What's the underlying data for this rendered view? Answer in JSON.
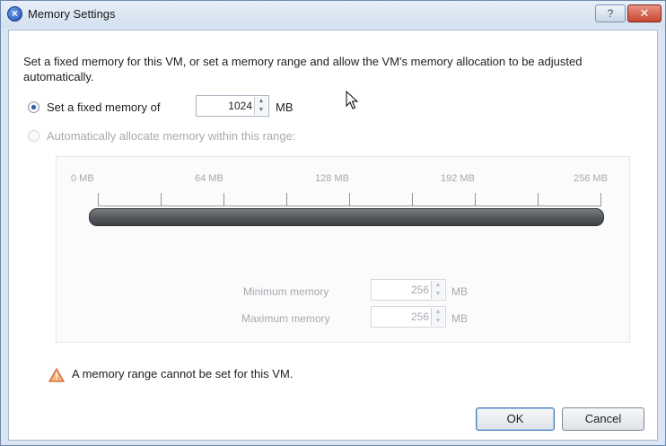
{
  "window": {
    "title": "Memory Settings",
    "help_label": "?",
    "close_label": "✕"
  },
  "description": "Set a fixed memory for this VM, or set a memory range and allow the VM's memory allocation to be adjusted automatically.",
  "fixed_option": {
    "label": "Set a fixed memory of",
    "value": "1024",
    "unit": "MB",
    "selected": true
  },
  "auto_option": {
    "label": "Automatically allocate memory within this range:",
    "selected": false,
    "enabled": false
  },
  "range": {
    "tick_labels": [
      "0 MB",
      "64 MB",
      "128 MB",
      "192 MB",
      "256 MB"
    ],
    "min_label": "Minimum memory",
    "min_value": "256",
    "max_label": "Maximum memory",
    "max_value": "256",
    "unit": "MB"
  },
  "warning": {
    "icon": "warning-triangle-icon",
    "text": "A memory range cannot be set for this VM."
  },
  "buttons": {
    "ok": "OK",
    "cancel": "Cancel"
  },
  "colors": {
    "title_icon": "#1f4fb3",
    "close_button": "#c74630",
    "warning_icon": "#e8743a"
  }
}
